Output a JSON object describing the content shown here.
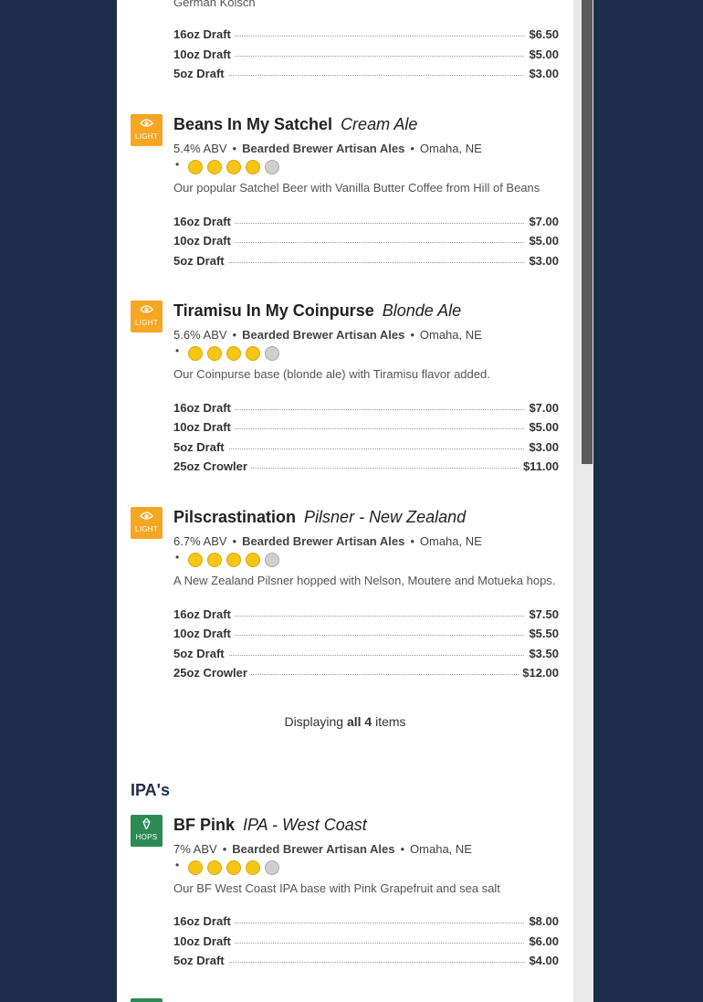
{
  "prev_beer": {
    "description": "German Kolsch",
    "prices": [
      {
        "size": "16oz Draft",
        "price": "$6.50"
      },
      {
        "size": "10oz Draft",
        "price": "$5.00"
      },
      {
        "size": "5oz Draft",
        "price": "$3.00"
      }
    ]
  },
  "beers": [
    {
      "name": "Beans In My Satchel",
      "style": "Cream Ale",
      "icon_label": "LIGHT",
      "icon_color": "#f6a623",
      "abv": "5.4% ABV",
      "brewery": "Bearded Brewer Artisan Ales",
      "location": "Omaha, NE",
      "rating": "4 of 5",
      "description": "Our popular Satchel Beer with Vanilla Butter Coffee from Hill of Beans",
      "prices": [
        {
          "size": "16oz Draft",
          "price": "$7.00"
        },
        {
          "size": "10oz Draft",
          "price": "$5.00"
        },
        {
          "size": "5oz Draft",
          "price": "$3.00"
        }
      ]
    },
    {
      "name": "Tiramisu In My Coinpurse",
      "style": "Blonde Ale",
      "icon_label": "LIGHT",
      "icon_color": "#f6a623",
      "abv": "5.6% ABV",
      "brewery": "Bearded Brewer Artisan Ales",
      "location": "Omaha, NE",
      "rating": "4 of 5",
      "description": "Our Coinpurse base (blonde ale) with Tiramisu flavor added.",
      "prices": [
        {
          "size": "16oz Draft",
          "price": "$7.00"
        },
        {
          "size": "10oz Draft",
          "price": "$5.00"
        },
        {
          "size": "5oz Draft",
          "price": "$3.00"
        },
        {
          "size": "25oz Crowler",
          "price": "$11.00"
        }
      ]
    },
    {
      "name": "Pilscrastination",
      "style": "Pilsner - New Zealand",
      "icon_label": "LIGHT",
      "icon_color": "#f6a623",
      "abv": "6.7% ABV",
      "brewery": "Bearded Brewer Artisan Ales",
      "location": "Omaha, NE",
      "rating": "4 of 5",
      "description": "A New Zealand Pilsner hopped with Nelson, Moutere and Motueka hops.",
      "prices": [
        {
          "size": "16oz Draft",
          "price": "$7.50"
        },
        {
          "size": "10oz Draft",
          "price": "$5.50"
        },
        {
          "size": "5oz Draft",
          "price": "$3.50"
        },
        {
          "size": "25oz Crowler",
          "price": "$12.00"
        }
      ]
    },
    {
      "name": "BF Pink",
      "style": "IPA - West Coast",
      "icon_label": "HOPS",
      "icon_color": "#2c8a55",
      "abv": "7% ABV",
      "brewery": "Bearded Brewer Artisan Ales",
      "location": "Omaha, NE",
      "rating": "4 of 5",
      "description": "Our BF West Coast IPA base with Pink Grapefruit and sea salt",
      "prices": [
        {
          "size": "16oz Draft",
          "price": "$8.00"
        },
        {
          "size": "10oz Draft",
          "price": "$6.00"
        },
        {
          "size": "5oz Draft",
          "price": "$4.00"
        }
      ]
    }
  ],
  "display_count": {
    "prefix": "Displaying",
    "strong": "all 4",
    "suffix": "items"
  },
  "section_ipa": {
    "title": "IPA's"
  },
  "separator": "•",
  "colors": {
    "background": "#1e2d4a",
    "rating_on": "#f7c514",
    "light_icon": "#f6a623",
    "hops_icon": "#2c8a55"
  }
}
